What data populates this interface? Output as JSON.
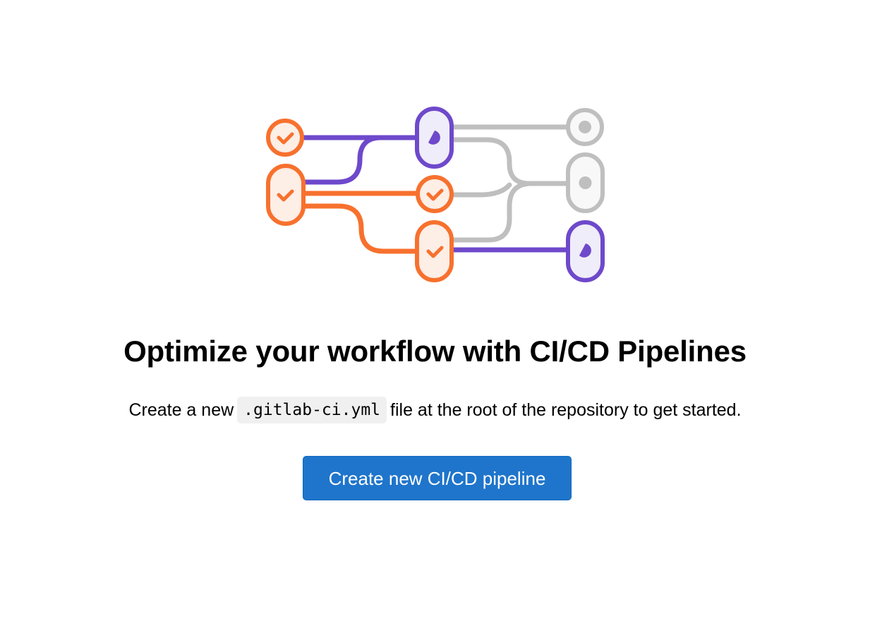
{
  "empty_state": {
    "title": "Optimize your workflow with CI/CD Pipelines",
    "description_before": "Create a new",
    "description_code": ".gitlab-ci.yml",
    "description_after": "file at the root of the repository to get started.",
    "button_label": "Create new CI/CD pipeline"
  },
  "illustration": {
    "icons": [
      "check-icon",
      "running-icon",
      "pending-icon"
    ]
  },
  "colors": {
    "success": "#f7712e",
    "success_fill": "#fdeee6",
    "running": "#6e49cb",
    "running_fill": "#efedf9",
    "pending": "#bfbfbf",
    "pending_fill": "#f8f8f8",
    "button": "#1f75cb"
  }
}
